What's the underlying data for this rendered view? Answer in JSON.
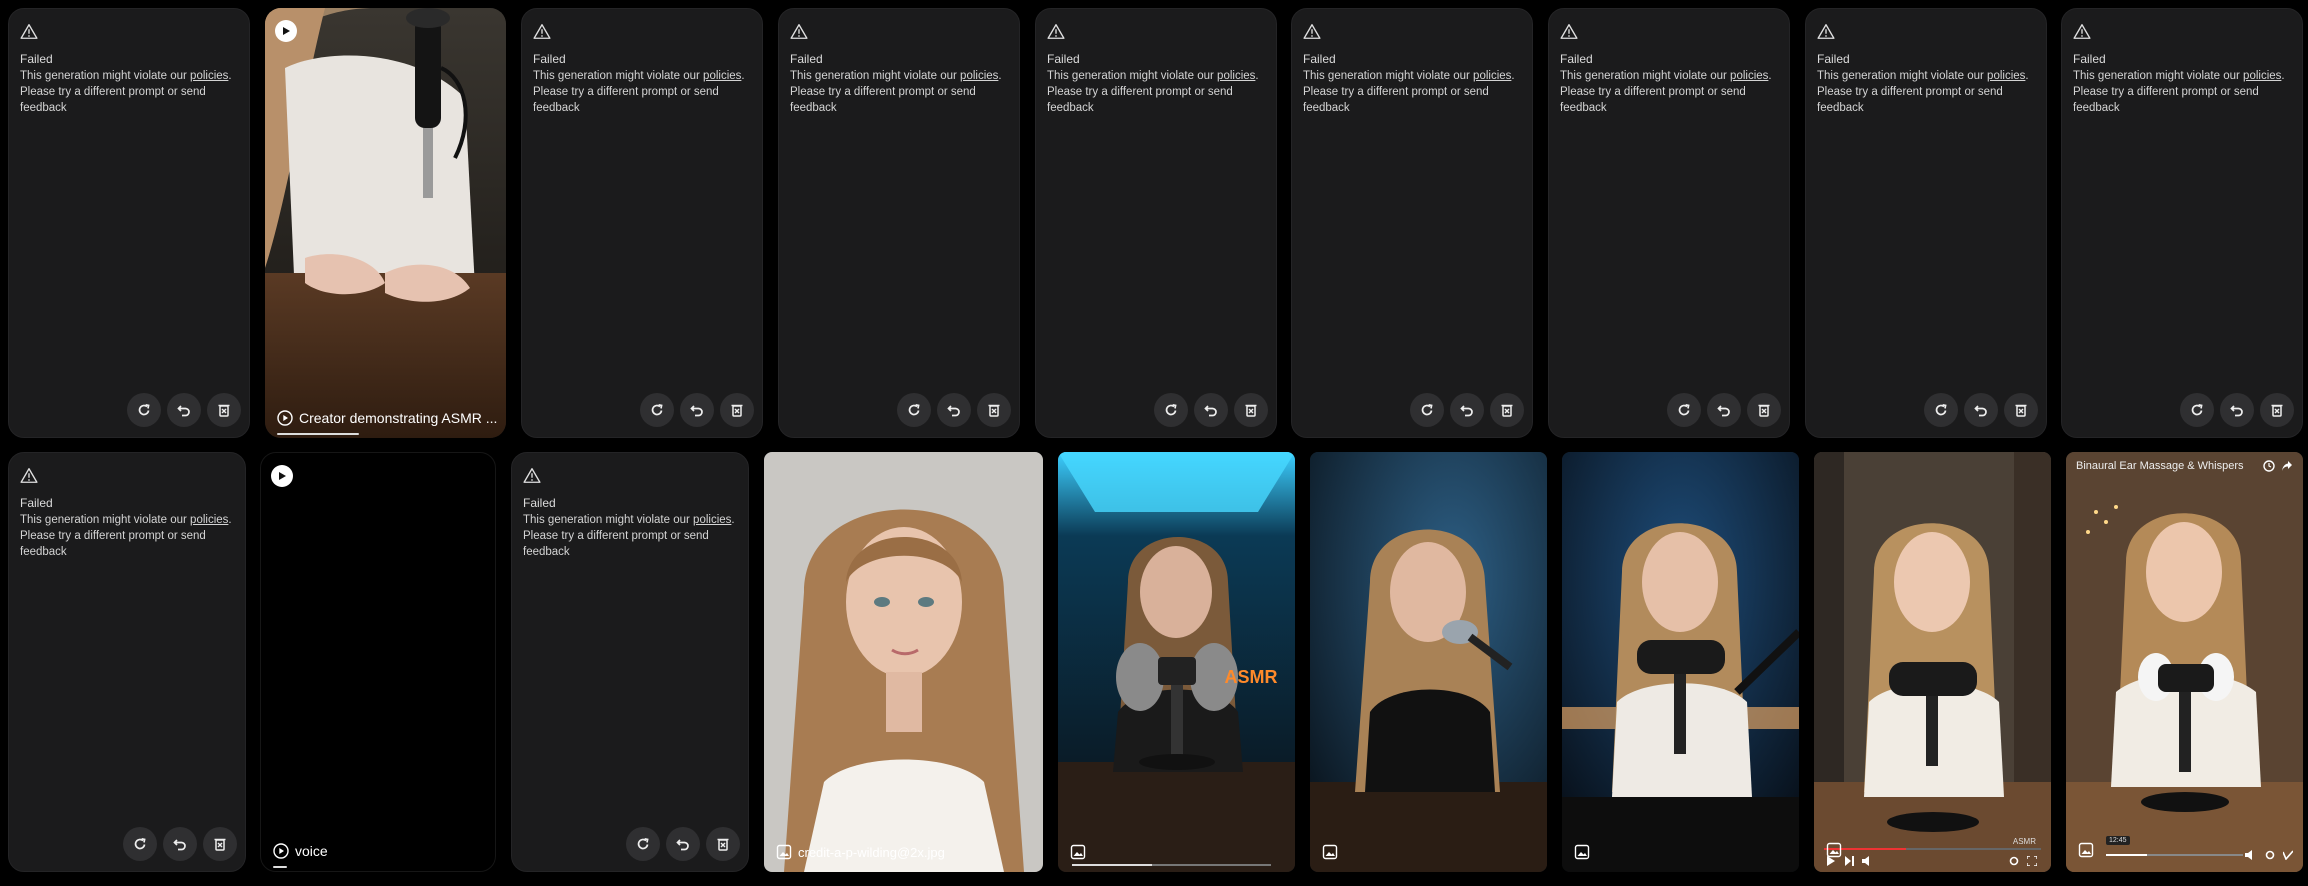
{
  "failed_card": {
    "title": "Failed",
    "message_before": "This generation might violate our ",
    "policies_link": "policies",
    "message_after": ". Please try a different prompt or send feedback"
  },
  "video_cards": {
    "creator": {
      "label": "Creator demonstrating ASMR ..."
    },
    "voice": {
      "label": "voice"
    }
  },
  "image_cards": {
    "credit": {
      "label": "credit-a-p-wilding@2x.jpg"
    },
    "neon_sign": "ASMR",
    "watermark": "ASMR",
    "youtube_title": "Binaural Ear Massage & Whispers",
    "youtube_time": "12:45"
  },
  "colors": {
    "card_bg": "#1b1b1c",
    "button_bg": "#2f2f31",
    "page_bg": "#000000"
  }
}
